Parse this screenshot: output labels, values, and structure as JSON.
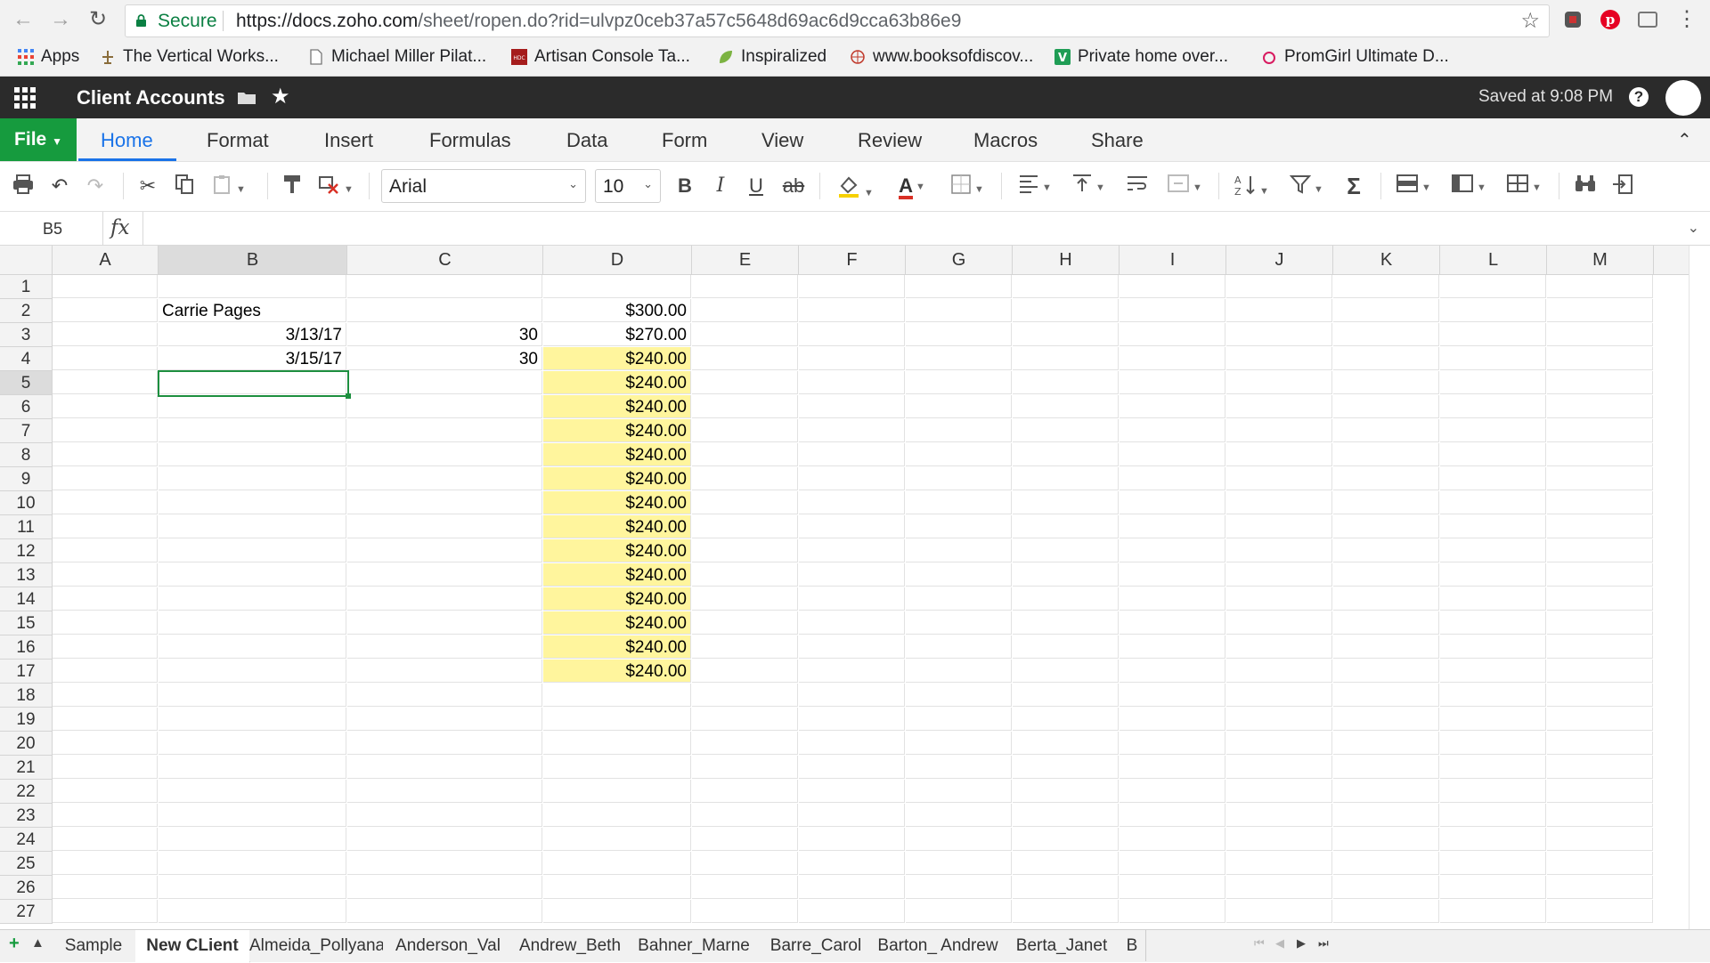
{
  "browser": {
    "secure_label": "Secure",
    "url_domain": "https://docs.zoho.com",
    "url_path": "/sheet/ropen.do?rid=ulvpz0ceb37a57c5648d69ac6d9cca63b86e9",
    "bookmarks": [
      {
        "label": "Apps"
      },
      {
        "label": "The Vertical Works..."
      },
      {
        "label": "Michael Miller Pilat..."
      },
      {
        "label": "Artisan Console Ta..."
      },
      {
        "label": "Inspiralized"
      },
      {
        "label": "www.booksofdiscov..."
      },
      {
        "label": "Private home over..."
      },
      {
        "label": "PromGirl Ultimate D..."
      }
    ]
  },
  "app": {
    "title": "Client Accounts",
    "saved_status": "Saved at 9:08 PM",
    "help_glyph": "?"
  },
  "menu": {
    "file": "File",
    "items": [
      "Home",
      "Format",
      "Insert",
      "Formulas",
      "Data",
      "Form",
      "View",
      "Review",
      "Macros",
      "Share"
    ]
  },
  "toolbar": {
    "font": "Arial",
    "font_size": "10",
    "bold": "B",
    "italic": "I",
    "underline": "U",
    "strike": "ab",
    "text_color_glyph": "A"
  },
  "formula_bar": {
    "cell_ref": "B5",
    "fx": "fx",
    "formula": ""
  },
  "grid": {
    "columns": [
      "A",
      "B",
      "C",
      "D",
      "E",
      "F",
      "G",
      "H",
      "I",
      "J",
      "K",
      "L",
      "M"
    ],
    "row_count": 27,
    "selected_cell": "B5",
    "highlight_color": "#fff59d",
    "selection_color": "#1d8f3f",
    "cells": [
      {
        "ref": "B2",
        "value": "Carrie Pages",
        "align": "left"
      },
      {
        "ref": "D2",
        "value": "$300.00",
        "align": "right"
      },
      {
        "ref": "B3",
        "value": "3/13/17",
        "align": "right"
      },
      {
        "ref": "C3",
        "value": "30",
        "align": "right"
      },
      {
        "ref": "D3",
        "value": "$270.00",
        "align": "right"
      },
      {
        "ref": "B4",
        "value": "3/15/17",
        "align": "right"
      },
      {
        "ref": "C4",
        "value": "30",
        "align": "right"
      },
      {
        "ref": "D4",
        "value": "$240.00",
        "align": "right",
        "highlight": true
      },
      {
        "ref": "D5",
        "value": "$240.00",
        "align": "right",
        "highlight": true
      },
      {
        "ref": "D6",
        "value": "$240.00",
        "align": "right",
        "highlight": true
      },
      {
        "ref": "D7",
        "value": "$240.00",
        "align": "right",
        "highlight": true
      },
      {
        "ref": "D8",
        "value": "$240.00",
        "align": "right",
        "highlight": true
      },
      {
        "ref": "D9",
        "value": "$240.00",
        "align": "right",
        "highlight": true
      },
      {
        "ref": "D10",
        "value": "$240.00",
        "align": "right",
        "highlight": true
      },
      {
        "ref": "D11",
        "value": "$240.00",
        "align": "right",
        "highlight": true
      },
      {
        "ref": "D12",
        "value": "$240.00",
        "align": "right",
        "highlight": true
      },
      {
        "ref": "D13",
        "value": "$240.00",
        "align": "right",
        "highlight": true
      },
      {
        "ref": "D14",
        "value": "$240.00",
        "align": "right",
        "highlight": true
      },
      {
        "ref": "D15",
        "value": "$240.00",
        "align": "right",
        "highlight": true
      },
      {
        "ref": "D16",
        "value": "$240.00",
        "align": "right",
        "highlight": true
      },
      {
        "ref": "D17",
        "value": "$240.00",
        "align": "right",
        "highlight": true
      }
    ]
  },
  "sheets": {
    "tabs": [
      "Sample",
      "New CLient",
      "Almeida_Pollyana",
      "Anderson_Val",
      "Andrew_Beth",
      "Bahner_Marne",
      "Barre_Carol",
      "Barton_ Andrew",
      "Berta_Janet",
      "B"
    ],
    "active": "New CLient"
  },
  "colors": {
    "file_button": "#169b3e",
    "accent": "#1a73e8",
    "header_bg": "#2b2b2b"
  }
}
